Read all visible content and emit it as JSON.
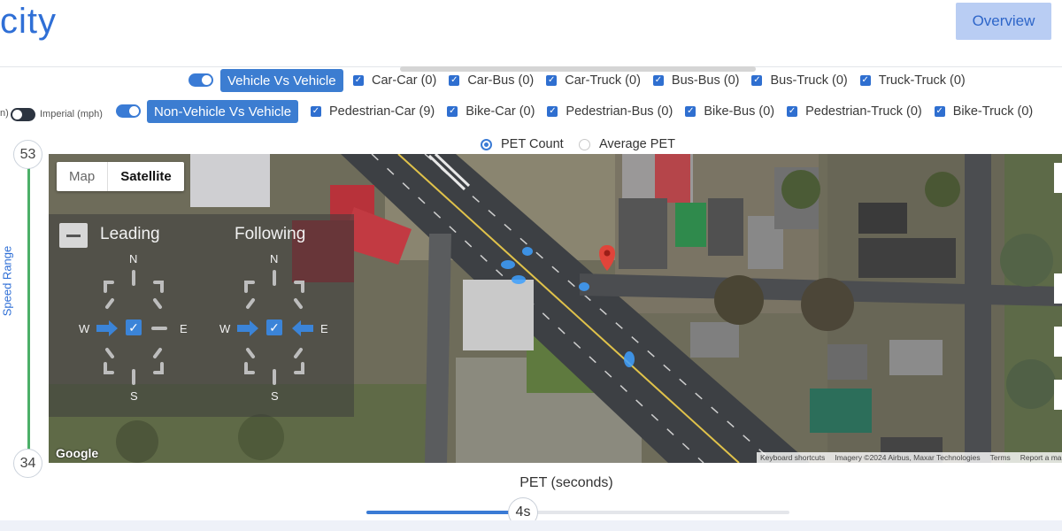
{
  "header": {
    "logo_text": "city",
    "overview_label": "Overview"
  },
  "units": {
    "left_label": "n)",
    "imperial_label": "Imperial (mph)"
  },
  "vehicle_group": {
    "label": "Vehicle Vs Vehicle",
    "enabled": true,
    "items": [
      {
        "label": "Car-Car (0)"
      },
      {
        "label": "Car-Bus (0)"
      },
      {
        "label": "Car-Truck (0)"
      },
      {
        "label": "Bus-Bus (0)"
      },
      {
        "label": "Bus-Truck (0)"
      },
      {
        "label": "Truck-Truck (0)"
      }
    ]
  },
  "nonvehicle_group": {
    "label": "Non-Vehicle Vs Vehicle",
    "enabled": true,
    "items": [
      {
        "label": "Pedestrian-Car (9)"
      },
      {
        "label": "Bike-Car (0)"
      },
      {
        "label": "Pedestrian-Bus (0)"
      },
      {
        "label": "Bike-Bus (0)"
      },
      {
        "label": "Pedestrian-Truck (0)"
      },
      {
        "label": "Bike-Truck (0)"
      }
    ]
  },
  "metric": {
    "options": [
      "PET Count",
      "Average PET"
    ],
    "selected": "PET Count"
  },
  "speed_range": {
    "label": "Speed Range",
    "max": "53",
    "min": "34"
  },
  "map": {
    "type_options": [
      "Map",
      "Satellite"
    ],
    "selected_type": "Satellite",
    "leading_title": "Leading",
    "following_title": "Following",
    "compass": {
      "n": "N",
      "s": "S",
      "e": "E",
      "w": "W"
    },
    "google_label": "Google",
    "attribution": [
      "Keyboard shortcuts",
      "Imagery ©2024 Airbus, Maxar Technologies",
      "Terms",
      "Report a ma"
    ]
  },
  "pet": {
    "label": "PET (seconds)",
    "value_label": "4s",
    "fraction": 0.37
  },
  "colors": {
    "accent": "#3a7bd5",
    "brand": "#2f6fd6",
    "speed_track": "#4caf68",
    "marker": "#e0443a"
  }
}
